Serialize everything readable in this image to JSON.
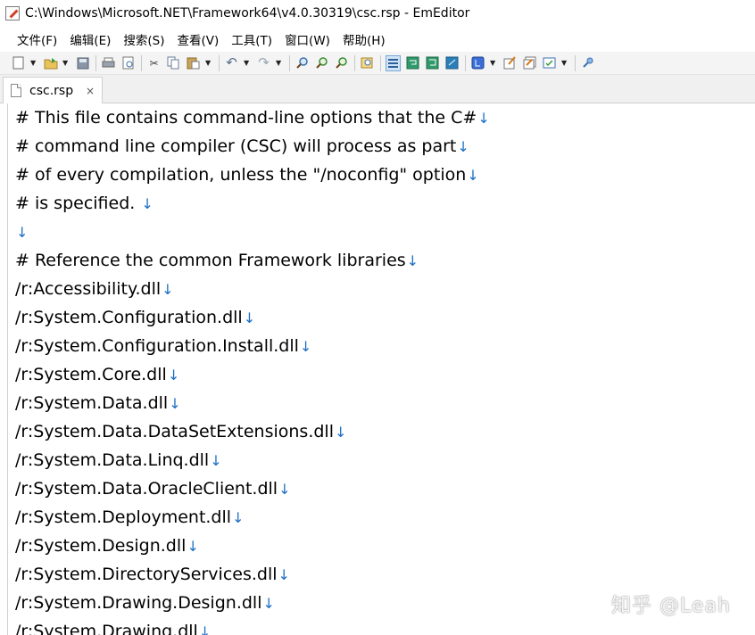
{
  "window": {
    "title": "C:\\Windows\\Microsoft.NET\\Framework64\\v4.0.30319\\csc.rsp - EmEditor"
  },
  "menu": [
    {
      "label": "文件(F)"
    },
    {
      "label": "编辑(E)"
    },
    {
      "label": "搜索(S)"
    },
    {
      "label": "查看(V)"
    },
    {
      "label": "工具(T)"
    },
    {
      "label": "窗口(W)"
    },
    {
      "label": "帮助(H)"
    }
  ],
  "tab": {
    "label": "csc.rsp",
    "close_glyph": "×"
  },
  "eol_glyph": "↓",
  "lines": [
    "# This file contains command-line options that the C#",
    "# command line compiler (CSC) will process as part",
    "# of every compilation, unless the \"/noconfig\" option",
    "# is specified. ",
    "",
    "# Reference the common Framework libraries",
    "/r:Accessibility.dll",
    "/r:System.Configuration.dll",
    "/r:System.Configuration.Install.dll",
    "/r:System.Core.dll",
    "/r:System.Data.dll",
    "/r:System.Data.DataSetExtensions.dll",
    "/r:System.Data.Linq.dll",
    "/r:System.Data.OracleClient.dll",
    "/r:System.Deployment.dll",
    "/r:System.Design.dll",
    "/r:System.DirectoryServices.dll",
    "/r:System.Drawing.Design.dll",
    "/r:System.Drawing.dll"
  ],
  "watermark": "知乎 @Leah",
  "colors": {
    "eol_mark": "#1d6fc4",
    "toolbar_bg": "#f4f4f4",
    "tabbar_bg": "#f0f0f0"
  }
}
